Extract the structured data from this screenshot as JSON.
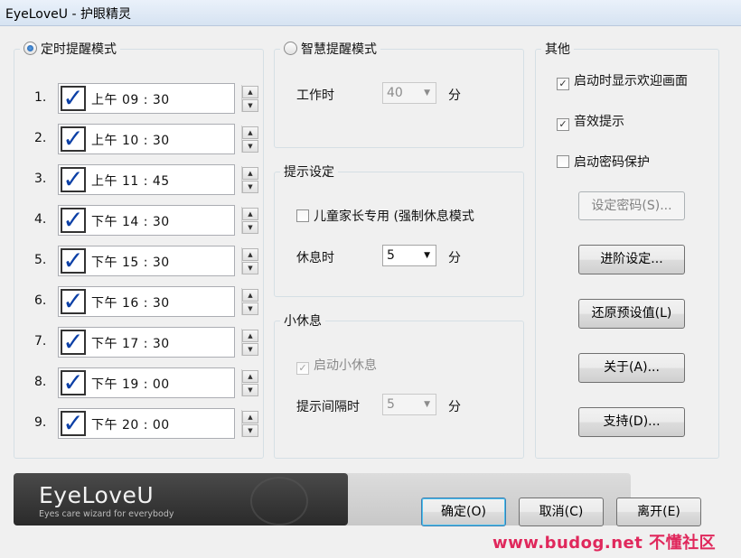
{
  "window": {
    "title": "EyeLoveU - 护眼精灵"
  },
  "timer_mode": {
    "label": "定时提醒模式",
    "rows": [
      {
        "num": "1.",
        "time": "上午 09 : 30"
      },
      {
        "num": "2.",
        "time": "上午 10 : 30"
      },
      {
        "num": "3.",
        "time": "上午 11 : 45"
      },
      {
        "num": "4.",
        "time": "下午 14 : 30"
      },
      {
        "num": "5.",
        "time": "下午 15 : 30"
      },
      {
        "num": "6.",
        "time": "下午 16 : 30"
      },
      {
        "num": "7.",
        "time": "下午 17 : 30"
      },
      {
        "num": "8.",
        "time": "下午 19 : 00"
      },
      {
        "num": "9.",
        "time": "下午 20 : 00"
      }
    ]
  },
  "smart_mode": {
    "label": "智慧提醒模式",
    "work_label": "工作时",
    "work_value": "40",
    "unit": "分"
  },
  "reminder": {
    "legend": "提示设定",
    "kids_label": "儿童家长专用 (强制休息模式",
    "rest_label": "休息时",
    "rest_value": "5",
    "unit": "分"
  },
  "mini_break": {
    "legend": "小休息",
    "enable_label": "启动小休息",
    "interval_label": "提示间隔时",
    "interval_value": "5",
    "unit": "分"
  },
  "other": {
    "legend": "其他",
    "show_welcome": "启动时显示欢迎画面",
    "sound": "音效提示",
    "password_protect": "启动密码保护",
    "set_password": "设定密码(S)...",
    "advanced": "进阶设定...",
    "restore_defaults": "还原预设值(L)",
    "about": "关于(A)...",
    "support": "支持(D)..."
  },
  "footer": {
    "ok": "确定(O)",
    "cancel": "取消(C)",
    "leave": "离开(E)",
    "logo": "EyeLoveU",
    "tagline": "Eyes care wizard for everybody",
    "watermark": "www.budog.net 不懂社区"
  }
}
